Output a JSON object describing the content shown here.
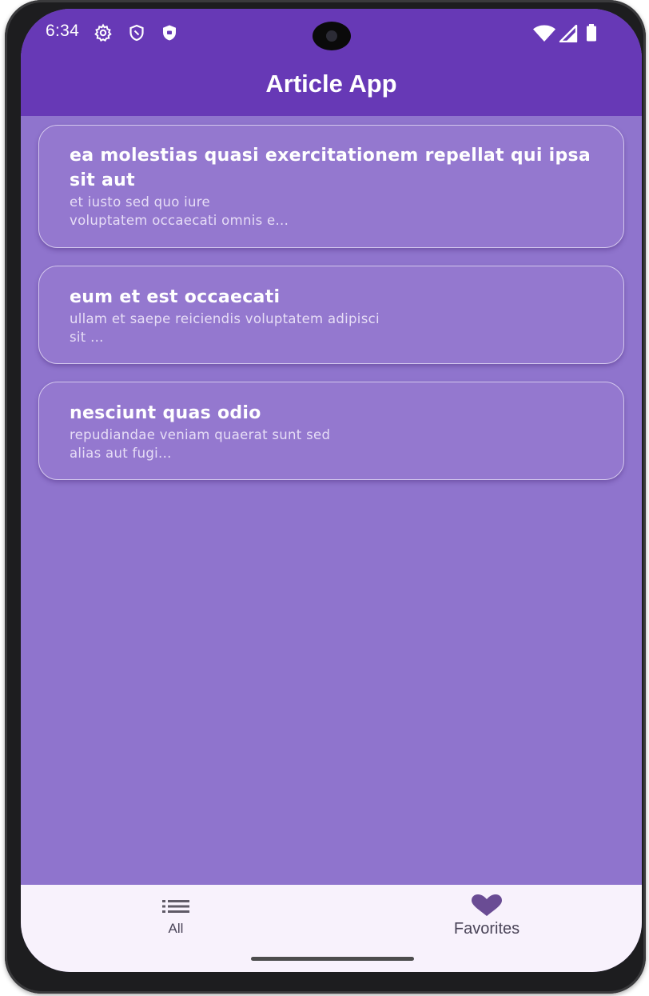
{
  "status_bar": {
    "time": "6:34",
    "icons": [
      "settings-gear-icon",
      "shield-outline-icon",
      "shield-filled-icon",
      "wifi-icon",
      "cellular-signal-icon",
      "battery-icon"
    ]
  },
  "app_bar": {
    "title": "Article App"
  },
  "articles": [
    {
      "title": "ea molestias quasi exercitationem repellat qui ipsa sit aut",
      "body": "et iusto sed quo iure\nvoluptatem occaecati omnis e..."
    },
    {
      "title": "eum et est occaecati",
      "body": "ullam et saepe reiciendis voluptatem adipisci\nsit ..."
    },
    {
      "title": "nesciunt quas odio",
      "body": "repudiandae veniam quaerat sunt sed\nalias aut fugi..."
    }
  ],
  "bottom_nav": {
    "items": [
      {
        "label": "All",
        "icon": "list-icon"
      },
      {
        "label": "Favorites",
        "icon": "heart-icon",
        "selected": true
      }
    ]
  },
  "colors": {
    "app_bar": "#6739b6",
    "background": "#8f74cd",
    "card": "#9478cf",
    "nav_background": "#f8f2fc",
    "nav_icon": "#6a4c94"
  }
}
